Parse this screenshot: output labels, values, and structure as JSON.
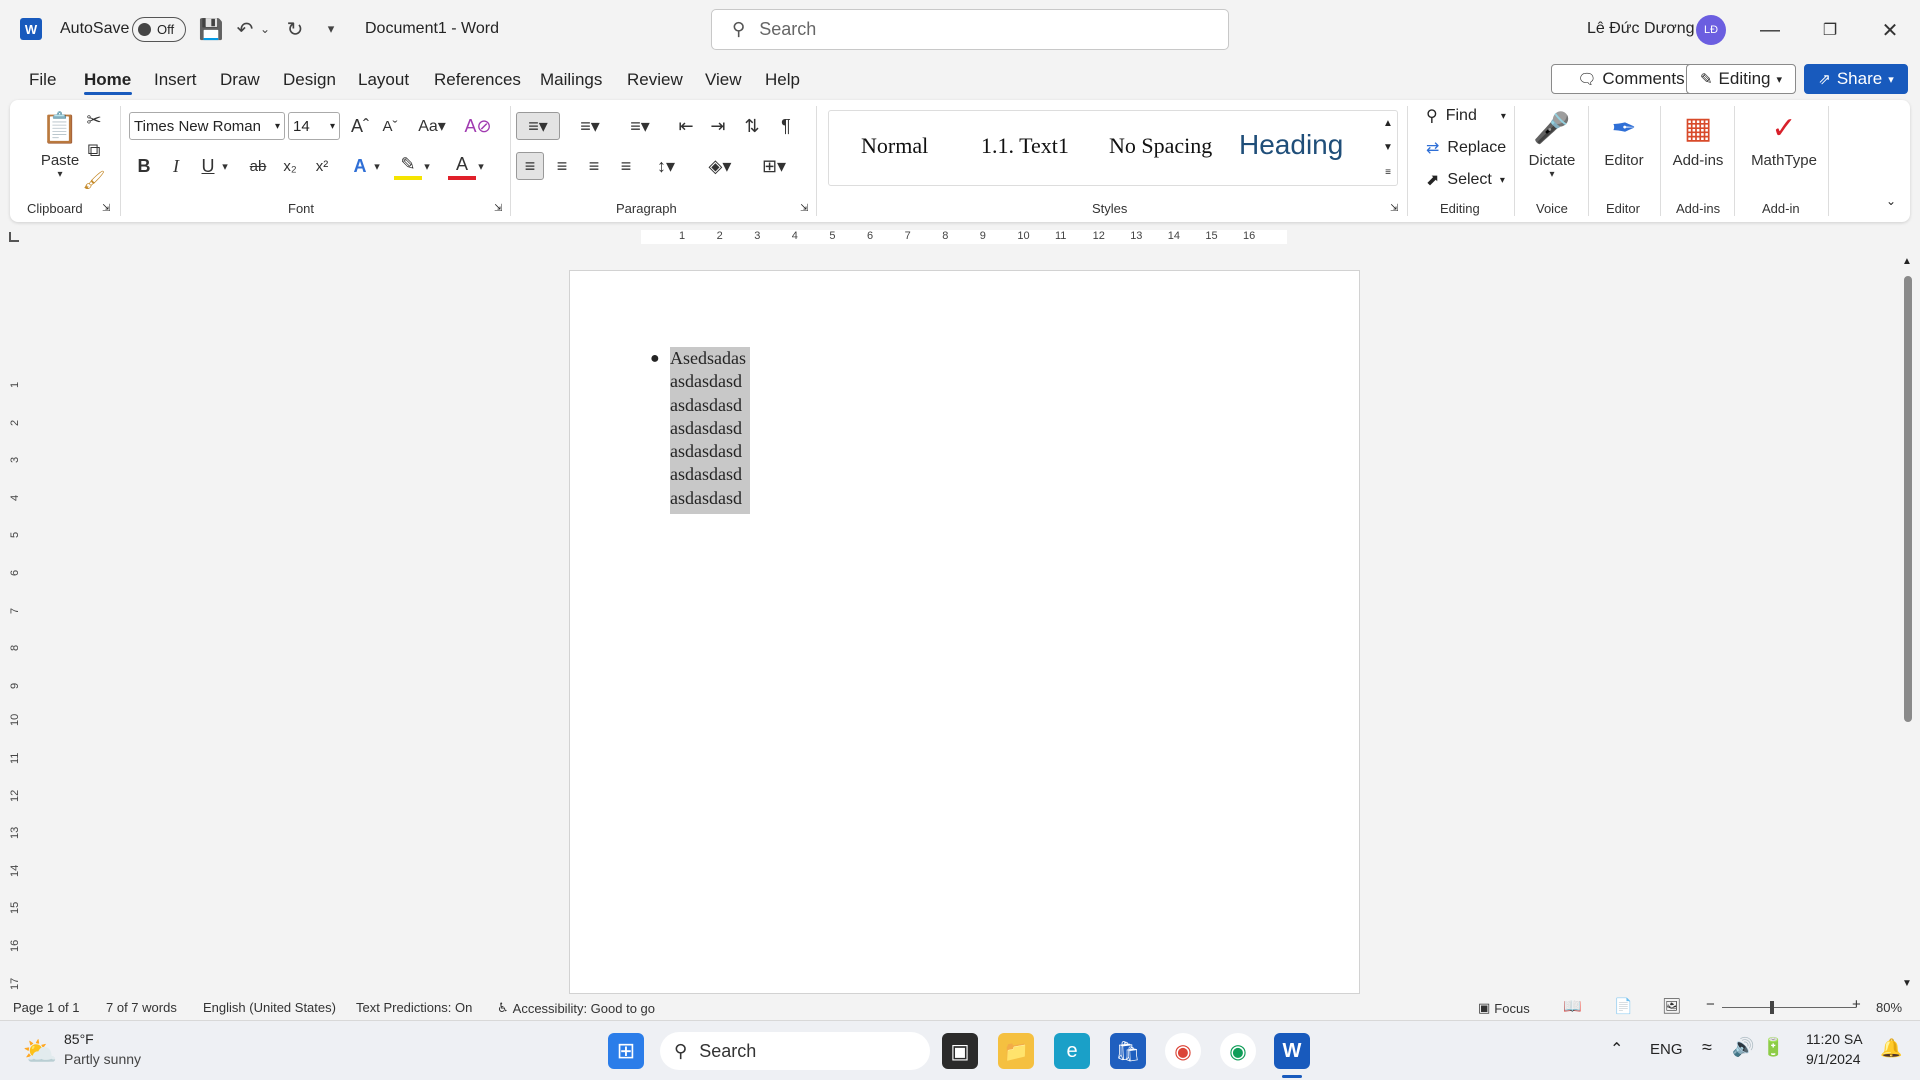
{
  "titlebar": {
    "autosave_label": "AutoSave",
    "autosave_state": "Off",
    "doc_title": "Document1  -  Word",
    "search_placeholder": "Search",
    "user_name": "Lê Đức Dương",
    "user_initials": "LĐ"
  },
  "menu": {
    "tabs": [
      "File",
      "Home",
      "Insert",
      "Draw",
      "Design",
      "Layout",
      "References",
      "Mailings",
      "Review",
      "View",
      "Help"
    ],
    "active": "Home",
    "comments_label": "Comments",
    "editing_label": "Editing",
    "share_label": "Share"
  },
  "ribbon": {
    "clipboard": {
      "label": "Clipboard",
      "paste": "Paste"
    },
    "font": {
      "label": "Font",
      "name": "Times New Roman",
      "size": "14"
    },
    "paragraph": {
      "label": "Paragraph"
    },
    "styles": {
      "label": "Styles",
      "items": [
        "Normal",
        "1.1.  Text1",
        "No Spacing",
        "Heading"
      ]
    },
    "editing": {
      "label": "Editing",
      "find": "Find",
      "replace": "Replace",
      "select": "Select"
    },
    "voice": {
      "label": "Voice",
      "dictate": "Dictate"
    },
    "editor": {
      "label": "Editor",
      "button": "Editor"
    },
    "addins": {
      "label": "Add-ins",
      "button": "Add-ins"
    },
    "addin": {
      "label": "Add-in",
      "button": "MathType"
    }
  },
  "ruler": {
    "h_ticks": [
      "1",
      "2",
      "3",
      "4",
      "5",
      "6",
      "7",
      "8",
      "9",
      "10",
      "11",
      "12",
      "13",
      "14",
      "15",
      "16"
    ],
    "v_ticks": [
      "1",
      "2",
      "3",
      "4",
      "5",
      "6",
      "7",
      "8",
      "9",
      "10",
      "11",
      "12",
      "13",
      "14",
      "15",
      "16",
      "17"
    ]
  },
  "document": {
    "lines": [
      "Asedsadas",
      "asdasdasd",
      "asdasdasd",
      "asdasdasd",
      "asdasdasd",
      "asdasdasd",
      "asdasdasd"
    ]
  },
  "status": {
    "page": "Page 1 of 1",
    "words": "7 of 7 words",
    "language": "English (United States)",
    "predictions": "Text Predictions: On",
    "accessibility": "Accessibility: Good to go",
    "focus": "Focus",
    "zoom": "80%"
  },
  "taskbar": {
    "weather_temp": "85°F",
    "weather_desc": "Partly sunny",
    "search": "Search",
    "lang": "ENG",
    "time": "11:20 SA",
    "date": "9/1/2024"
  },
  "colors": {
    "accent": "#185abd",
    "selection": "#c8c8c8"
  }
}
